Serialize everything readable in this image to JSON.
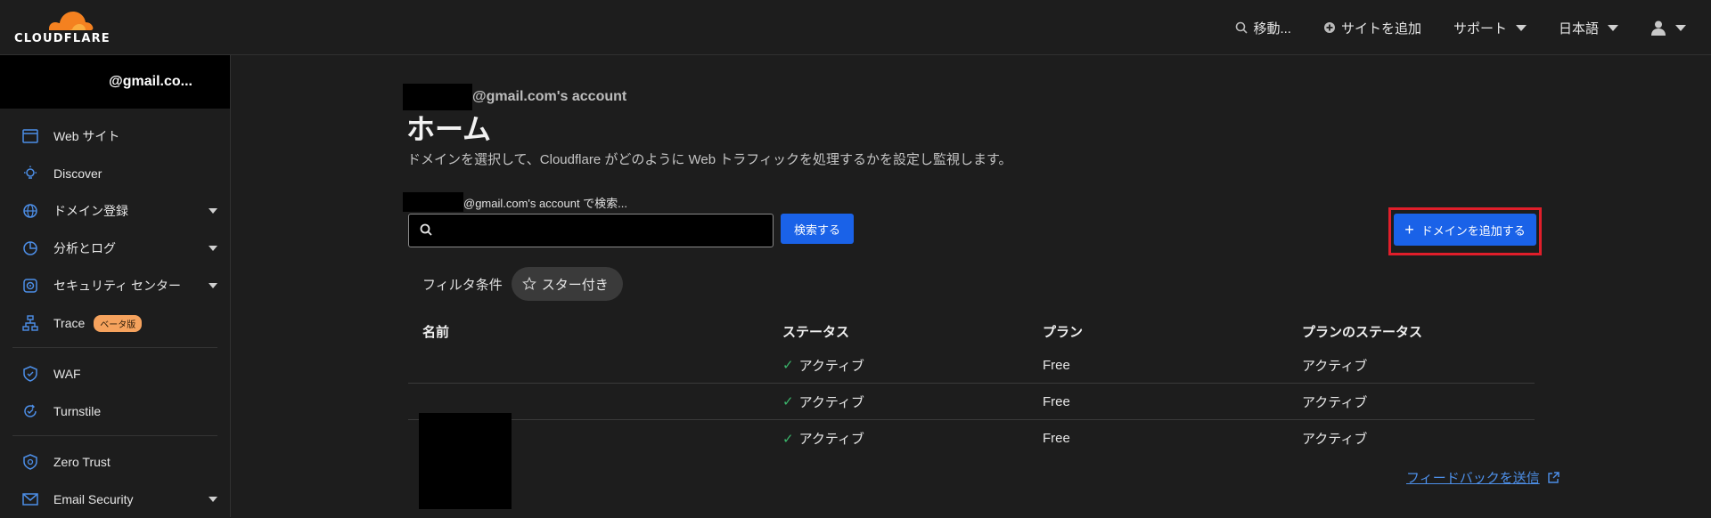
{
  "brand": {
    "name": "CLOUDFLARE",
    "accent": "#f48120"
  },
  "topnav": {
    "goto_label": "移動...",
    "add_site_label": "サイトを追加",
    "support_label": "サポート",
    "language_label": "日本語"
  },
  "sidebar": {
    "account_label": "@gmail.co...",
    "items": [
      {
        "label": "Web サイト",
        "icon": "browser-window-icon"
      },
      {
        "label": "Discover",
        "icon": "lightbulb-icon"
      },
      {
        "label": "ドメイン登録",
        "icon": "globe-icon"
      },
      {
        "label": "分析とログ",
        "icon": "pie-chart-icon"
      },
      {
        "label": "セキュリティ センター",
        "icon": "target-icon"
      },
      {
        "label": "Trace",
        "icon": "flow-icon",
        "badge": "ベータ版"
      },
      {
        "label": "WAF",
        "icon": "shield-icon"
      },
      {
        "label": "Turnstile",
        "icon": "refresh-check-icon"
      },
      {
        "label": "Zero Trust",
        "icon": "shield-check-icon"
      },
      {
        "label": "Email Security",
        "icon": "mail-icon"
      }
    ]
  },
  "main": {
    "account_line": "@gmail.com's account",
    "title": "ホーム",
    "description": "ドメインを選択して、Cloudflare がどのように Web トラフィックを処理するかを設定し監視します。",
    "search_label": "@gmail.com's account で検索...",
    "search_value": "",
    "search_button": "検索する",
    "add_domain_button": "ドメインを追加する",
    "filter_label": "フィルタ条件",
    "starred_chip": "スター付き",
    "table": {
      "headers": [
        "名前",
        "ステータス",
        "プラン",
        "プランのステータス"
      ],
      "rows": [
        {
          "name": "",
          "status": "アクティブ",
          "plan": "Free",
          "plan_status": "アクティブ"
        },
        {
          "name": "",
          "status": "アクティブ",
          "plan": "Free",
          "plan_status": "アクティブ"
        },
        {
          "name": "",
          "status": "アクティブ",
          "plan": "Free",
          "plan_status": "アクティブ"
        }
      ]
    },
    "feedback_link": "フィードバックを送信"
  },
  "colors": {
    "primary_button": "#1a62e8",
    "highlight_frame": "#e01e2a",
    "active_check": "#3bb56b",
    "link": "#4d8fe8"
  }
}
